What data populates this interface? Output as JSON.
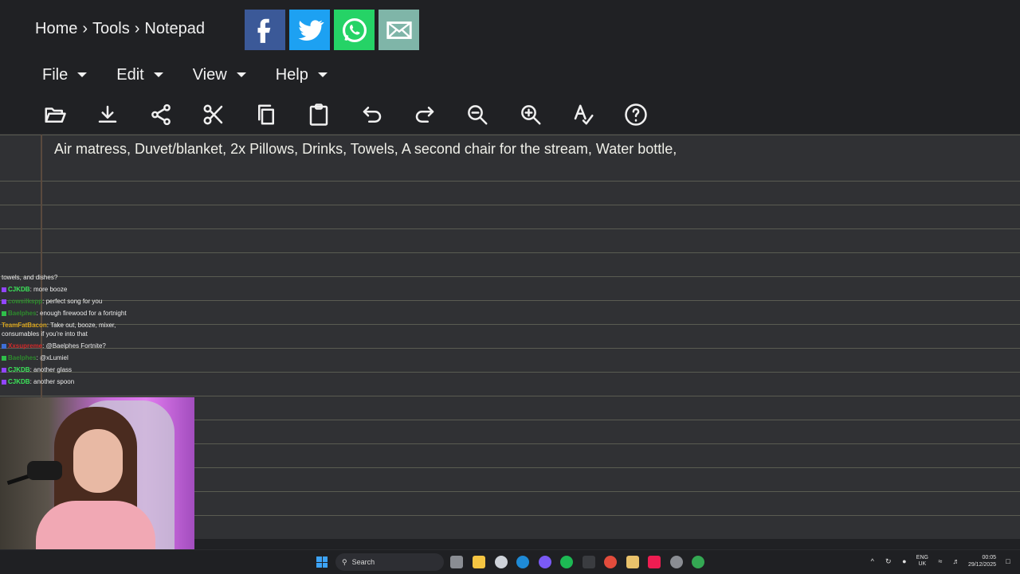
{
  "breadcrumb": {
    "items": [
      "Home",
      "Tools",
      "Notepad"
    ],
    "separator": "›"
  },
  "share": [
    {
      "name": "facebook-icon",
      "color": "#3b5998"
    },
    {
      "name": "twitter-icon",
      "color": "#1da1f2"
    },
    {
      "name": "whatsapp-icon",
      "color": "#25d366"
    },
    {
      "name": "email-icon",
      "color": "#7fb5a8"
    }
  ],
  "menu": {
    "file": "File",
    "edit": "Edit",
    "view": "View",
    "help": "Help"
  },
  "toolbar": [
    "open-icon",
    "download-icon",
    "share-icon",
    "cut-icon",
    "copy-icon",
    "paste-icon",
    "undo-icon",
    "redo-icon",
    "zoom-out-icon",
    "zoom-in-icon",
    "spellcheck-icon",
    "help-icon"
  ],
  "editor": {
    "text": "Air matress, Duvet/blanket, 2x Pillows, Drinks, Towels, A second chair for the stream, Water bottle,"
  },
  "chat": {
    "lines": [
      {
        "name": "",
        "text": "towels, and dishes?",
        "color": "#ececec"
      },
      {
        "name": "CJKDB",
        "text": "more booze",
        "color": "#3ce55a"
      },
      {
        "name": "cowsilkspp",
        "text": "perfect song for you",
        "color": "#2d8a2d"
      },
      {
        "name": "Baelphes",
        "text": "enough firewood for a fortnight",
        "color": "#2d8a2d"
      },
      {
        "name": "TeamFatBacon",
        "text": "Take out, booze, mixer, consumables if you're into that",
        "color": "#d6a21c"
      },
      {
        "name": "Xxsupreme",
        "text": "@Baelphes Fortnite?",
        "color": "#d02a2a"
      },
      {
        "name": "Baelphes",
        "text": "@xLumiel",
        "color": "#2d8a2d"
      },
      {
        "name": "CJKDB",
        "text": "another glass",
        "color": "#3ce55a"
      },
      {
        "name": "CJKDB",
        "text": "another spoon",
        "color": "#3ce55a"
      }
    ]
  },
  "taskbar": {
    "search_label": "Search",
    "lang_top": "ENG",
    "lang_bottom": "UK",
    "time": "00:05",
    "date": "29/12/2025"
  }
}
